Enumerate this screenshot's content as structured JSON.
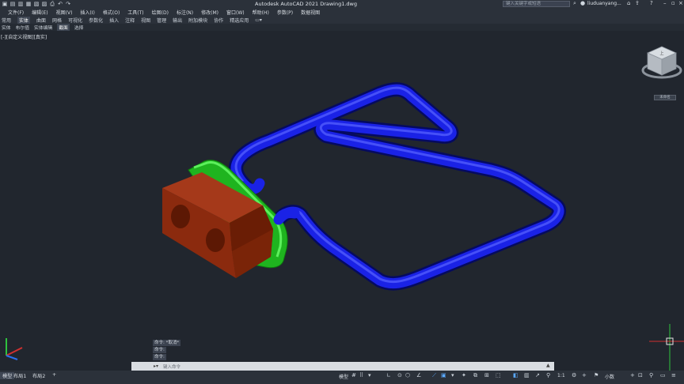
{
  "app": {
    "title": "Autodesk AutoCAD 2021    Drawing1.dwg",
    "search_placeholder": "键入关键字或短语",
    "user_name": "liuduanyang..."
  },
  "menu": [
    "文件(F)",
    "编辑(E)",
    "视图(V)",
    "插入(I)",
    "格式(O)",
    "工具(T)",
    "绘图(D)",
    "标注(N)",
    "修改(M)",
    "窗口(W)",
    "帮助(H)",
    "参数(P)",
    "数据视图"
  ],
  "ribbon_tabs": [
    "常用",
    "实体",
    "曲面",
    "网格",
    "可视化",
    "参数化",
    "插入",
    "注释",
    "视图",
    "管理",
    "输出",
    "附加模块",
    "协作",
    "精选应用"
  ],
  "panel_row": [
    "实体",
    "布尔值",
    "实体编辑",
    "截面",
    "选择"
  ],
  "viewport": {
    "label": "[-][自定义视图][真实]",
    "viewcube_face_top": "上",
    "unnamed_button": "未命名"
  },
  "command": {
    "history": [
      "命令: *取消*",
      "命令:",
      "命令:"
    ],
    "placeholder": "键入命令"
  },
  "status": {
    "layout_tabs": [
      "模型",
      "布局1",
      "布局2"
    ],
    "add_tab": "+",
    "model_label": "模型",
    "scale": "1:1",
    "units": "小数"
  },
  "colors": {
    "pipe": "#1018d8",
    "block": "#8b2a0e",
    "flange": "#2bd12b",
    "background": "#21262e"
  }
}
